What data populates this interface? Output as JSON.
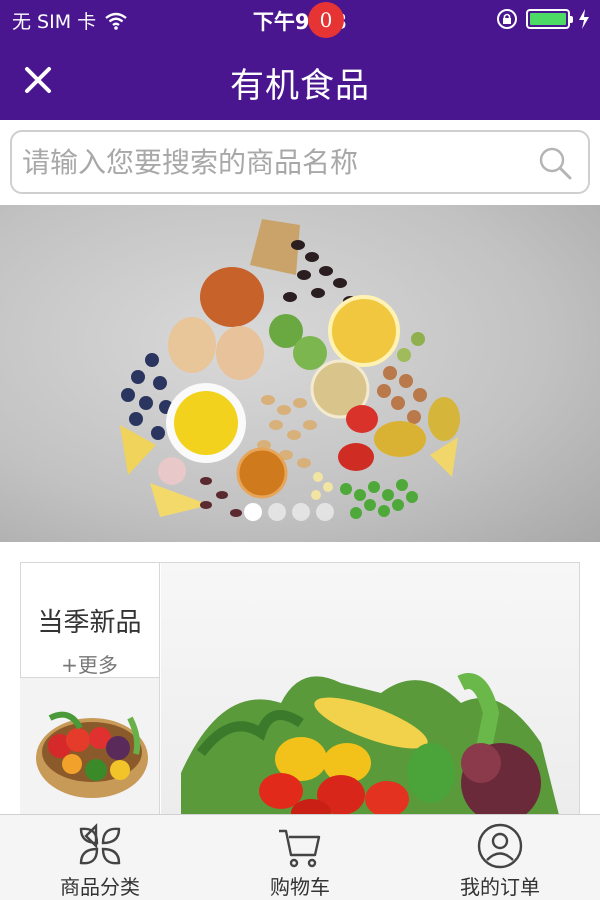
{
  "status_bar": {
    "carrier": "无 SIM 卡",
    "time": "下午9:03",
    "battery_level": 1.0
  },
  "nav": {
    "title": "有机食品",
    "close_icon": "close-icon"
  },
  "search": {
    "placeholder": "请输入您要搜索的商品名称",
    "value": "",
    "icon": "search-icon"
  },
  "banner": {
    "slide_count": 4,
    "active_index": 0
  },
  "section": {
    "title": "当季新品",
    "more_label": "+更多"
  },
  "tabbar": {
    "items": [
      {
        "label": "商品分类",
        "icon": "category-icon"
      },
      {
        "label": "购物车",
        "icon": "cart-icon",
        "badge": "0"
      },
      {
        "label": "我的订单",
        "icon": "user-icon"
      }
    ]
  },
  "colors": {
    "header": "#4a1690",
    "badge": "#e63333",
    "battery": "#4cd964"
  }
}
